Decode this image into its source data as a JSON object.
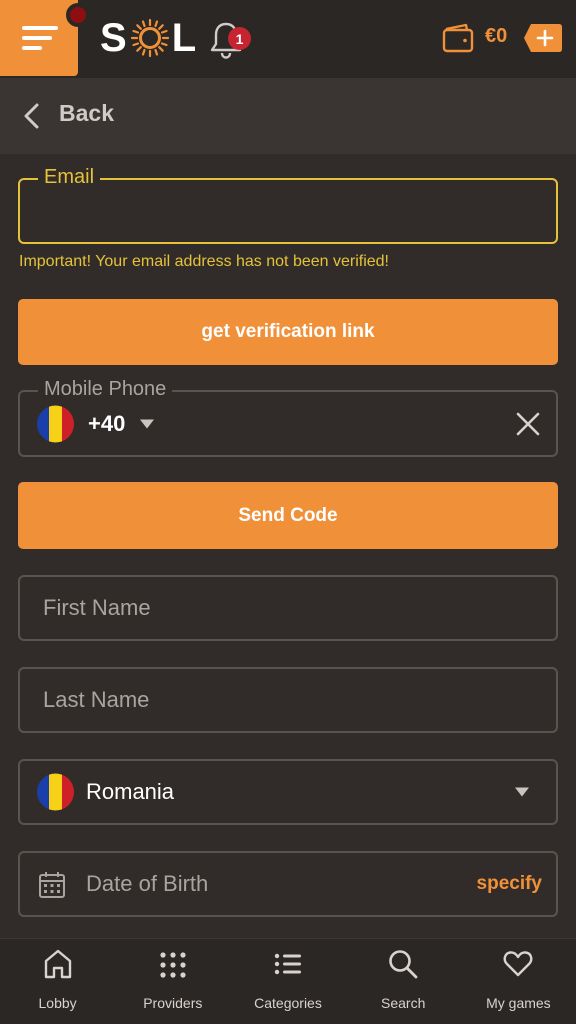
{
  "header": {
    "logo_left": "S",
    "logo_right": "L",
    "notification_count": "1",
    "balance": "€0"
  },
  "back": {
    "label": "Back"
  },
  "email": {
    "label": "Email",
    "value": "",
    "warning": "Important! Your email address has not been verified!"
  },
  "verify_button": "get verification link",
  "phone": {
    "label": "Mobile Phone",
    "country_code": "+40",
    "value": ""
  },
  "send_code_button": "Send Code",
  "first_name": {
    "placeholder": "First Name"
  },
  "last_name": {
    "placeholder": "Last Name"
  },
  "country": {
    "value": "Romania"
  },
  "dob": {
    "placeholder": "Date of Birth",
    "action": "specify"
  },
  "nav": [
    {
      "label": "Lobby",
      "icon": "home-icon"
    },
    {
      "label": "Providers",
      "icon": "grid-icon"
    },
    {
      "label": "Categories",
      "icon": "list-icon"
    },
    {
      "label": "Search",
      "icon": "search-icon"
    },
    {
      "label": "My games",
      "icon": "heart-icon"
    }
  ],
  "colors": {
    "accent": "#f0913a",
    "warning": "#e5c23a",
    "background": "#312c29",
    "badge": "#c72431"
  }
}
